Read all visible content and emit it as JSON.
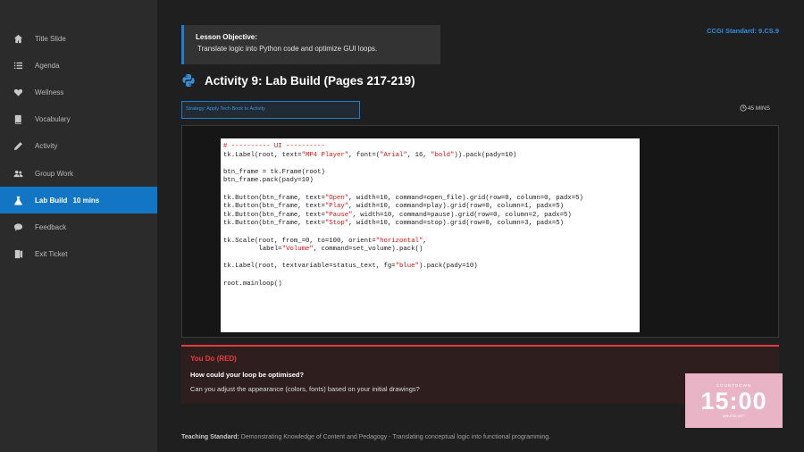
{
  "sidebar": {
    "items": [
      {
        "label": "Title Slide",
        "icon": "home-icon"
      },
      {
        "label": "Agenda",
        "icon": "list-icon"
      },
      {
        "label": "Wellness",
        "icon": "heart-icon"
      },
      {
        "label": "Vocabulary",
        "icon": "book-icon"
      },
      {
        "label": "Activity",
        "icon": "pencil-icon"
      },
      {
        "label": "Group Work",
        "icon": "users-icon"
      },
      {
        "label": "Lab Build",
        "icon": "flask-icon",
        "extra": "10 mins",
        "active": true
      },
      {
        "label": "Feedback",
        "icon": "comment-icon"
      },
      {
        "label": "Exit Ticket",
        "icon": "door-icon"
      }
    ]
  },
  "objective": {
    "title": "Lesson Objective:",
    "text": "Translate logic into Python code and optimize GUI loops."
  },
  "standard": "CCGI Standard: 9.CS.9",
  "heading": "Activity 9: Lab Build (Pages 217-219)",
  "strategy": "Strategy: Apply Tech Book to Activity",
  "timer": "45 MINS",
  "code": [
    "# ---------- UI ----------",
    "tk.Label(root, text=\"MP4 Player\", font=(\"Arial\", 16, \"bold\")).pack(pady=10)",
    "",
    "btn_frame = tk.Frame(root)",
    "btn_frame.pack(pady=10)",
    "",
    "tk.Button(btn_frame, text=\"Open\", width=10, command=open_file).grid(row=0, column=0, padx=5)",
    "tk.Button(btn_frame, text=\"Play\", width=10, command=play).grid(row=0, column=1, padx=5)",
    "tk.Button(btn_frame, text=\"Pause\", width=10, command=pause).grid(row=0, column=2, padx=5)",
    "tk.Button(btn_frame, text=\"Stop\", width=10, command=stop).grid(row=0, column=3, padx=5)",
    "",
    "tk.Scale(root, from_=0, to=100, orient=\"horizontal\",",
    "         label=\"Volume\", command=set_volume).pack()",
    "",
    "tk.Label(root, textvariable=status_text, fg=\"blue\").pack(pady=10)",
    "",
    "root.mainloop()"
  ],
  "youdo": {
    "label": "You Do (RED)",
    "question": "How could your loop be optimised?",
    "text": "Can you adjust the appearance (colors, fonts) based on your initial drawings?"
  },
  "countdown": {
    "label": "COUNTDOWN",
    "time": "15:00",
    "sub": "MINUTES LEFT"
  },
  "footer": {
    "label": "Teaching Standard:",
    "text": " Demonstrating Knowledge of Content and Pedagogy - Translating conceptual logic into functional programming."
  },
  "colors": {
    "accent": "#1376c4",
    "alert": "#e3393f"
  }
}
